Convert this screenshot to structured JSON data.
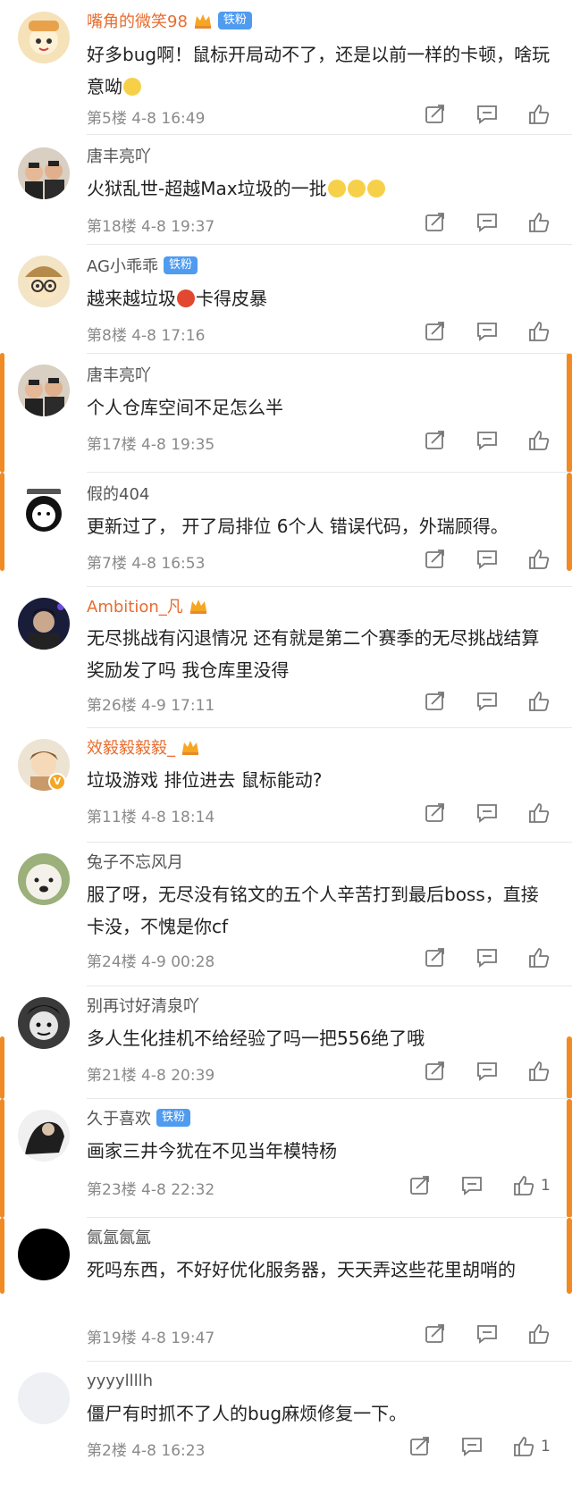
{
  "comments": [
    {
      "user": "嘴角的微笑98",
      "vip": true,
      "tag": "铁粉",
      "text": "好多bug啊！鼠标开局动不了，还是以前一样的卡顿，啥玩意呦",
      "emoji_after": "smirk",
      "floor": "第5楼",
      "date": "4-8 16:49",
      "likes": ""
    },
    {
      "user": "唐丰亮吖",
      "vip": false,
      "tag": "",
      "text": "火狱乱世-超越Max垃圾的一批",
      "emoji_after": "cry3",
      "floor": "第18楼",
      "date": "4-8 19:37",
      "likes": ""
    },
    {
      "user": "AG小乖乖",
      "vip": false,
      "tag": "铁粉",
      "text_before": "越来越垃圾",
      "text_after": "卡得皮暴",
      "emoji_mid": "angry",
      "floor": "第8楼",
      "date": "4-8 17:16",
      "likes": ""
    },
    {
      "user": "唐丰亮吖",
      "vip": false,
      "tag": "",
      "text": "个人仓库空间不足怎么半",
      "floor": "第17楼",
      "date": "4-8 19:35",
      "likes": ""
    },
    {
      "user": "假的404",
      "vip": false,
      "tag": "",
      "text": "更新过了， 开了局排位  6个人  错误代码，外瑞顾得。",
      "floor": "第7楼",
      "date": "4-8 16:53",
      "likes": ""
    },
    {
      "user": "Ambition_凡",
      "vip": true,
      "tag": "",
      "text": "无尽挑战有闪退情况    还有就是第二个赛季的无尽挑战结算奖励发了吗   我仓库里没得",
      "floor": "第26楼",
      "date": "4-9 17:11",
      "likes": ""
    },
    {
      "user": "效毅毅毅毅_",
      "vip": true,
      "tag": "",
      "text": "垃圾游戏 排位进去 鼠标能动?",
      "floor": "第11楼",
      "date": "4-8 18:14",
      "likes": ""
    },
    {
      "user": "兔子不忘风月",
      "vip": false,
      "tag": "",
      "text": "服了呀，无尽没有铭文的五个人辛苦打到最后boss，直接卡没，不愧是你cf",
      "floor": "第24楼",
      "date": "4-9 00:28",
      "likes": ""
    },
    {
      "user": "别再讨好清泉吖",
      "vip": false,
      "tag": "",
      "text": "多人生化挂机不给经验了吗一把556绝了哦",
      "floor": "第21楼",
      "date": "4-8 20:39",
      "likes": ""
    },
    {
      "user": "久于喜欢",
      "vip": false,
      "tag": "铁粉",
      "text": "画家三井今犹在不见当年模特杨",
      "floor": "第23楼",
      "date": "4-8 22:32",
      "likes": "1"
    },
    {
      "user": "氤氲氤氲",
      "vip": false,
      "tag": "",
      "text": "死吗东西，不好好优化服务器，天天弄这些花里胡哨的",
      "floor": "第19楼",
      "date": "4-8 19:47",
      "likes": ""
    },
    {
      "user": "yyyyllllh",
      "vip": false,
      "tag": "",
      "text": "僵尸有时抓不了人的bug麻烦修复一下。",
      "floor": "第2楼",
      "date": "4-8 16:23",
      "likes": "1"
    }
  ],
  "icons": {
    "share": "share-icon",
    "comment": "comment-icon",
    "like": "like-icon"
  },
  "colors": {
    "vip_name": "#e86c2f",
    "name": "#555555",
    "meta": "#8a8a8a",
    "tag_bg": "#4f9bf0",
    "accent": "#f08a24"
  }
}
